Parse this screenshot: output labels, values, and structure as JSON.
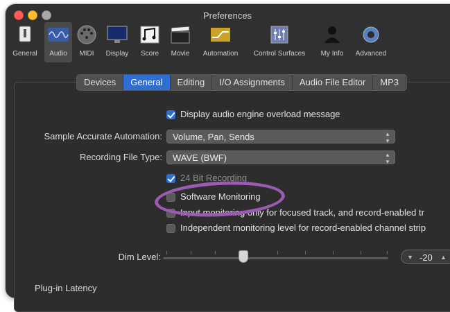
{
  "window": {
    "title": "Preferences"
  },
  "toolbar": {
    "items": [
      {
        "label": "General",
        "icon": "general-icon"
      },
      {
        "label": "Audio",
        "icon": "audio-icon"
      },
      {
        "label": "MIDI",
        "icon": "midi-icon"
      },
      {
        "label": "Display",
        "icon": "display-icon"
      },
      {
        "label": "Score",
        "icon": "score-icon"
      },
      {
        "label": "Movie",
        "icon": "movie-icon"
      },
      {
        "label": "Automation",
        "icon": "automation-icon"
      },
      {
        "label": "Control Surfaces",
        "icon": "control-surfaces-icon"
      },
      {
        "label": "My Info",
        "icon": "my-info-icon"
      },
      {
        "label": "Advanced",
        "icon": "advanced-icon"
      }
    ],
    "selected": "Audio"
  },
  "tabs": {
    "items": [
      "Devices",
      "General",
      "Editing",
      "I/O Assignments",
      "Audio File Editor",
      "MP3"
    ],
    "active": "General"
  },
  "general": {
    "overload_message": {
      "label": "Display audio engine overload message",
      "checked": true
    },
    "sample_accurate_automation": {
      "label": "Sample Accurate Automation:",
      "value": "Volume, Pan, Sends"
    },
    "recording_file_type": {
      "label": "Recording File Type:",
      "value": "WAVE (BWF)"
    },
    "bit_recording": {
      "label": "24 Bit Recording",
      "checked": true
    },
    "software_monitoring": {
      "label": "Software Monitoring",
      "checked": false
    },
    "input_monitoring": {
      "label": "Input monitoring only for focused track, and record-enabled tr",
      "checked": false
    },
    "independent_monitoring": {
      "label": "Independent monitoring level for record-enabled channel strip",
      "checked": false
    },
    "dim_level": {
      "label": "Dim Level:",
      "value": "-20",
      "down": "▼",
      "up": "▲"
    },
    "section_heading": "Plug-in Latency"
  },
  "colors": {
    "accent": "#2f6fd3",
    "highlight_ring": "#9b5bb2"
  }
}
